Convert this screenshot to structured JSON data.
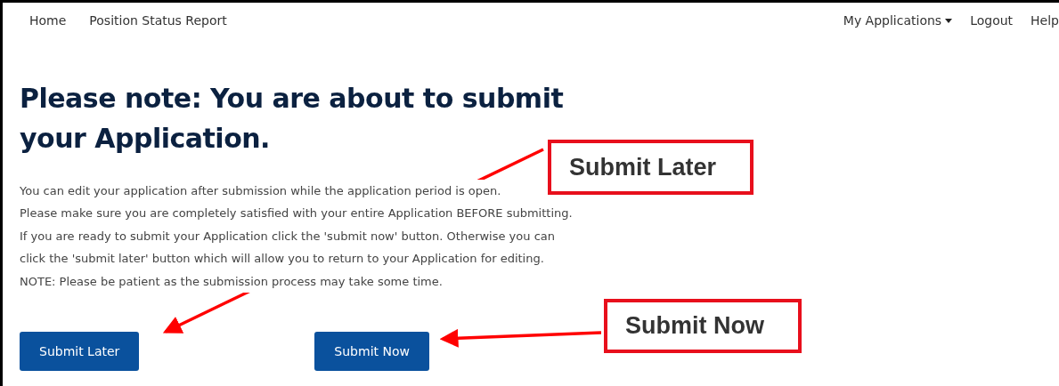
{
  "nav": {
    "left": [
      "Home",
      "Position Status Report"
    ],
    "applications_menu": "My Applications",
    "right": [
      "Logout",
      "Help"
    ]
  },
  "heading": "Please note: You are about to submit your Application.",
  "paragraph": [
    "You can edit your application after submission while the application period is open.",
    "Please make sure you are completely satisfied with your entire Application BEFORE submitting.",
    "If you are ready to submit your Application click the 'submit now' button. Otherwise you can",
    "click the 'submit later' button which will allow you to return to your Application for editing.",
    "NOTE: Please be patient as the submission process may take some time."
  ],
  "buttons": [
    "Submit Later",
    "Submit Now"
  ],
  "callouts": [
    "Submit Later",
    "Submit Now"
  ]
}
